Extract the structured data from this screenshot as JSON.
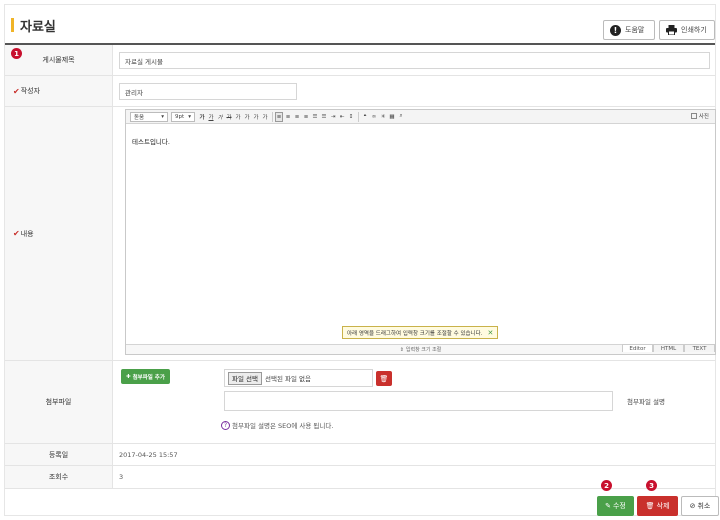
{
  "header": {
    "title": "자료실",
    "help_label": "도움말",
    "print_label": "인쇄하기"
  },
  "form": {
    "title_label": "게시물제목",
    "title_value": "자료실 게시물",
    "author_label": "작성자",
    "author_value": "관리자",
    "content_label": "내용",
    "attach_label": "첨부파일",
    "regdate_label": "등록일",
    "regdate_value": "2017-04-25 15:57",
    "views_label": "조회수",
    "views_value": "3"
  },
  "editor": {
    "font_select": "돋움",
    "size_select": "9pt",
    "toolbar_buttons": [
      "가",
      "가",
      "가",
      "가",
      "가",
      "가",
      "가",
      "가",
      "가"
    ],
    "right_label": "사진",
    "body_text": "테스트입니다.",
    "drag_tip": "아래 영역을 드래그하여 입력창 크기를 조절할 수 있습니다.",
    "resize_label": "입력창 크기 조절",
    "modes": [
      "Editor",
      "HTML",
      "TEXT"
    ]
  },
  "attachment": {
    "add_button": "첨부파일 추가",
    "choose_button": "파일 선택",
    "no_file": "선택된 파일 없음",
    "desc_label": "첨부파일 설명",
    "seo_note": "첨부파일 설명은 SEO에 사용 됩니다."
  },
  "actions": {
    "edit_label": "수정",
    "delete_label": "삭제",
    "cancel_label": "취소"
  },
  "markers": [
    "1",
    "2",
    "3"
  ],
  "colors": {
    "accent_bar": "#f0b428",
    "green": "#4aa049",
    "red": "#c9302c",
    "marker_red": "#c8102e"
  }
}
